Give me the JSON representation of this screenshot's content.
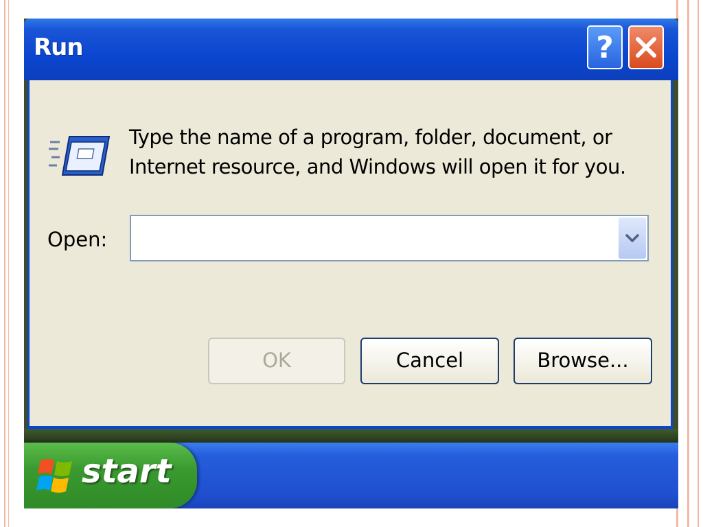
{
  "window": {
    "title": "Run",
    "help_icon": "help-icon",
    "close_icon": "close-icon"
  },
  "dialog": {
    "icon": "run-program-icon",
    "description_line1": "Type the name of a program, folder, document, or",
    "description_line2": "Internet resource, and Windows will open it for you.",
    "open_label": "Open:",
    "open_value": "",
    "buttons": {
      "ok": "OK",
      "cancel": "Cancel",
      "browse": "Browse..."
    }
  },
  "taskbar": {
    "start_label": "start",
    "start_icon": "windows-flag-icon"
  },
  "colors": {
    "titlebar_blue": "#0a46d0",
    "dialog_bg": "#ece9d8",
    "start_green": "#3a9a30",
    "close_red": "#d94a20",
    "slide_accent": "#f4b9a3"
  }
}
